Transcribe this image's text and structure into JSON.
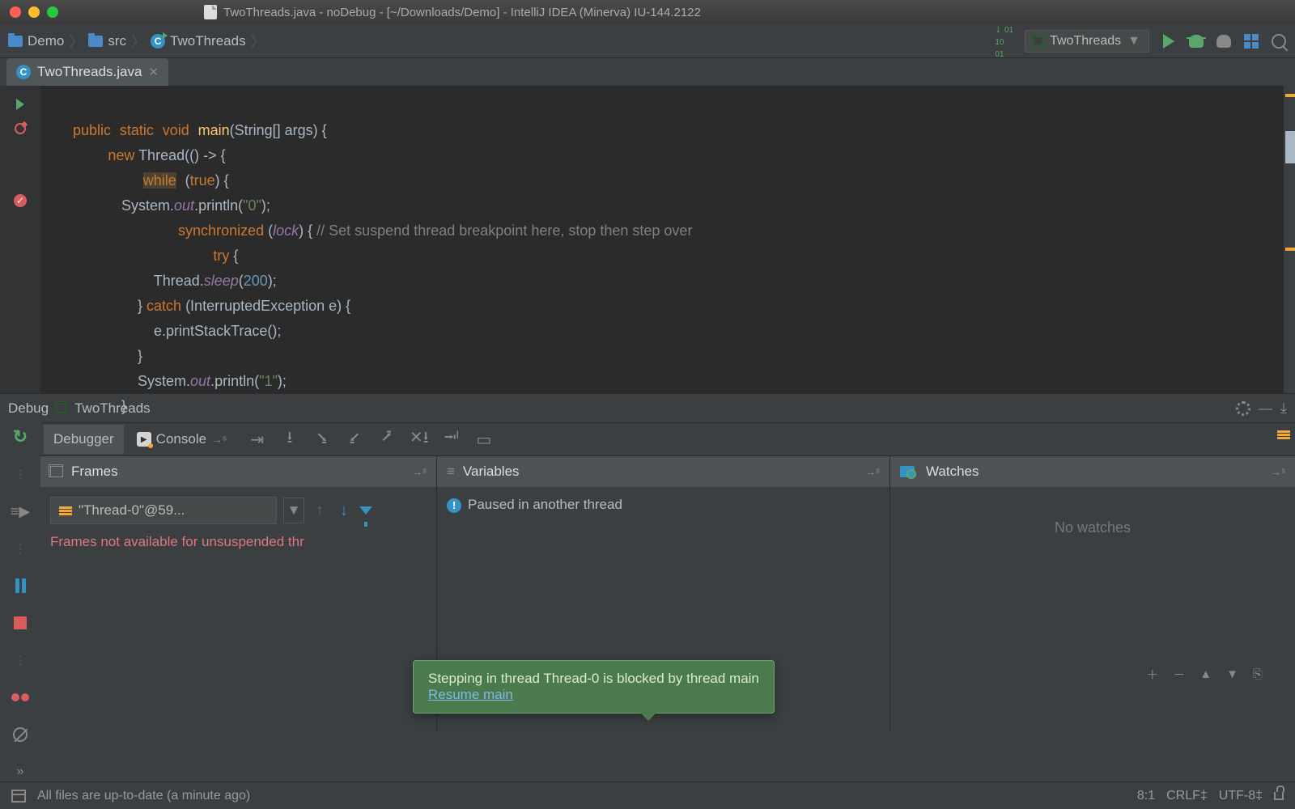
{
  "window": {
    "title": "TwoThreads.java - noDebug - [~/Downloads/Demo] - IntelliJ IDEA (Minerva) IU-144.2122"
  },
  "breadcrumbs": {
    "root": "Demo",
    "src": "src",
    "cls": "TwoThreads"
  },
  "runconfig": {
    "name": "TwoThreads"
  },
  "tab": {
    "name": "TwoThreads.java"
  },
  "code": {
    "l1a": "public",
    "l1b": "static",
    "l1c": "void",
    "l1d": "main",
    "l1e": "(String[] args) {",
    "l2a": "new",
    "l2b": " Thread(() -> {",
    "l3a": "while",
    "l3b": "(",
    "l3c": "true",
    "l3d": ") {",
    "l4a": "            System.",
    "l4b": "out",
    "l4c": ".println(",
    "l4d": "\"0\"",
    "l4e": ");",
    "l5a": "synchronized",
    "l5b": " (",
    "l5c": "lock",
    "l5d": ") { ",
    "l5e": "// Set suspend thread breakpoint here, stop then step over",
    "l6a": "try",
    "l6b": " {",
    "l7a": "                    Thread.",
    "l7b": "sleep",
    "l7c": "(",
    "l7d": "200",
    "l7e": ");",
    "l8a": "                } ",
    "l8b": "catch",
    "l8c": " (InterruptedException e) {",
    "l9": "                    e.printStackTrace();",
    "l10": "                }",
    "l11a": "                System.",
    "l11b": "out",
    "l11c": ".println(",
    "l11d": "\"1\"",
    "l11e": ");",
    "l12": "            }"
  },
  "debug": {
    "title": "Debug",
    "config": "TwoThreads"
  },
  "steptabs": {
    "debugger": "Debugger",
    "console": "Console"
  },
  "frames": {
    "title": "Frames",
    "thread": "\"Thread-0\"@59...",
    "msg": "Frames not available for unsuspended thr"
  },
  "vars": {
    "title": "Variables",
    "msg": "Paused in another thread"
  },
  "watches": {
    "title": "Watches",
    "msg": "No watches"
  },
  "tooltip": {
    "msg": "Stepping in thread Thread-0 is blocked by thread main",
    "link": "Resume main"
  },
  "status": {
    "msg": "All files are up-to-date (a minute ago)",
    "pos": "8:1",
    "sep": "CRLF",
    "enc": "UTF-8"
  }
}
